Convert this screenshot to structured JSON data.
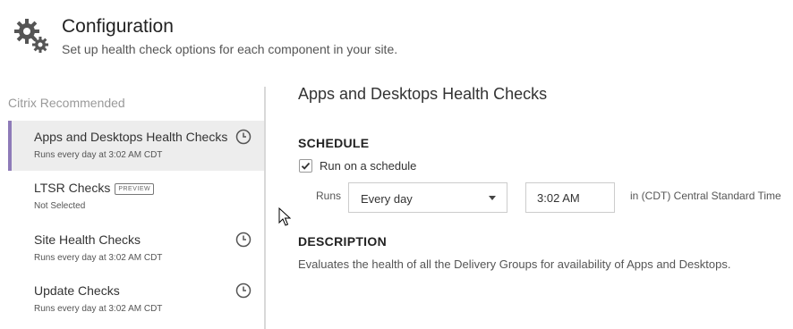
{
  "header": {
    "title": "Configuration",
    "subtitle": "Set up health check options for each component in your site.",
    "icon": "gears-icon"
  },
  "sidebar": {
    "heading": "Citrix Recommended",
    "items": [
      {
        "label": "Apps and Desktops Health Checks",
        "sub": "Runs every day at 3:02 AM CDT",
        "clock": true,
        "active": true
      },
      {
        "label": "LTSR Checks",
        "badge": "PREVIEW",
        "sub": "Not Selected",
        "clock": false,
        "active": false
      },
      {
        "label": "Site Health Checks",
        "sub": "Runs every day at 3:02 AM CDT",
        "clock": true,
        "active": false
      },
      {
        "label": "Update Checks",
        "sub": "Runs every day at 3:02 AM CDT",
        "clock": true,
        "active": false
      }
    ]
  },
  "main": {
    "title": "Apps and Desktops Health Checks",
    "schedule": {
      "heading": "SCHEDULE",
      "checkbox_label": "Run on a schedule",
      "checked": true,
      "runs_label": "Runs",
      "frequency": "Every day",
      "time": "3:02 AM",
      "timezone": "in (CDT) Central Standard Time"
    },
    "description": {
      "heading": "DESCRIPTION",
      "text": "Evaluates the health of all the Delivery Groups for availability of Apps and Desktops."
    }
  },
  "colors": {
    "accent": "#8e7bb8",
    "active_bg": "#ededed",
    "divider": "#d8d8d8"
  }
}
